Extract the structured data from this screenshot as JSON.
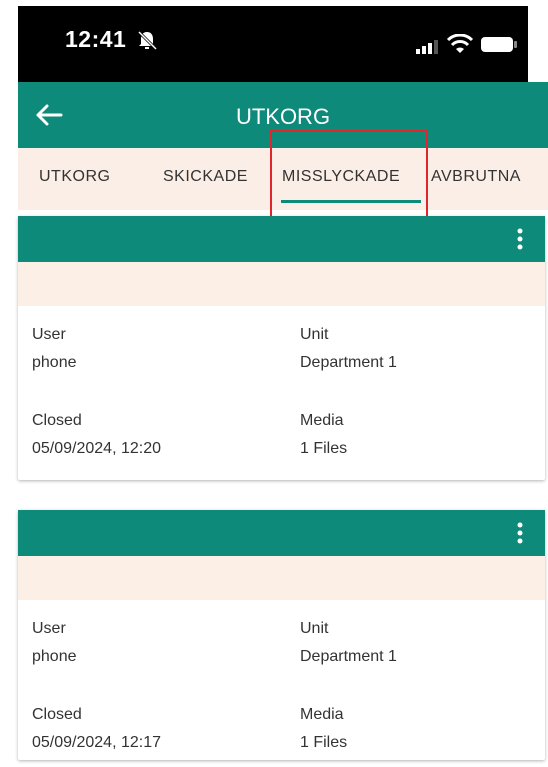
{
  "status_bar": {
    "time": "12:41"
  },
  "app_bar": {
    "title": "UTKORG"
  },
  "tabs": [
    {
      "label": "UTKORG"
    },
    {
      "label": "SKICKADE"
    },
    {
      "label": "MISSLYCKADE"
    },
    {
      "label": "AVBRUTNA"
    }
  ],
  "selected_tab": "MISSLYCKADE",
  "colors": {
    "accent": "#0d8a7a",
    "band": "#fcefe6",
    "highlight": "#e0262a"
  },
  "cards": [
    {
      "user_label": "User",
      "user_value": "phone",
      "unit_label": "Unit",
      "unit_value": "Department 1",
      "closed_label": "Closed",
      "closed_value": "05/09/2024, 12:20",
      "media_label": "Media",
      "media_value": "1 Files"
    },
    {
      "user_label": "User",
      "user_value": "phone",
      "unit_label": "Unit",
      "unit_value": "Department 1",
      "closed_label": "Closed",
      "closed_value": "05/09/2024, 12:17",
      "media_label": "Media",
      "media_value": "1 Files"
    }
  ]
}
